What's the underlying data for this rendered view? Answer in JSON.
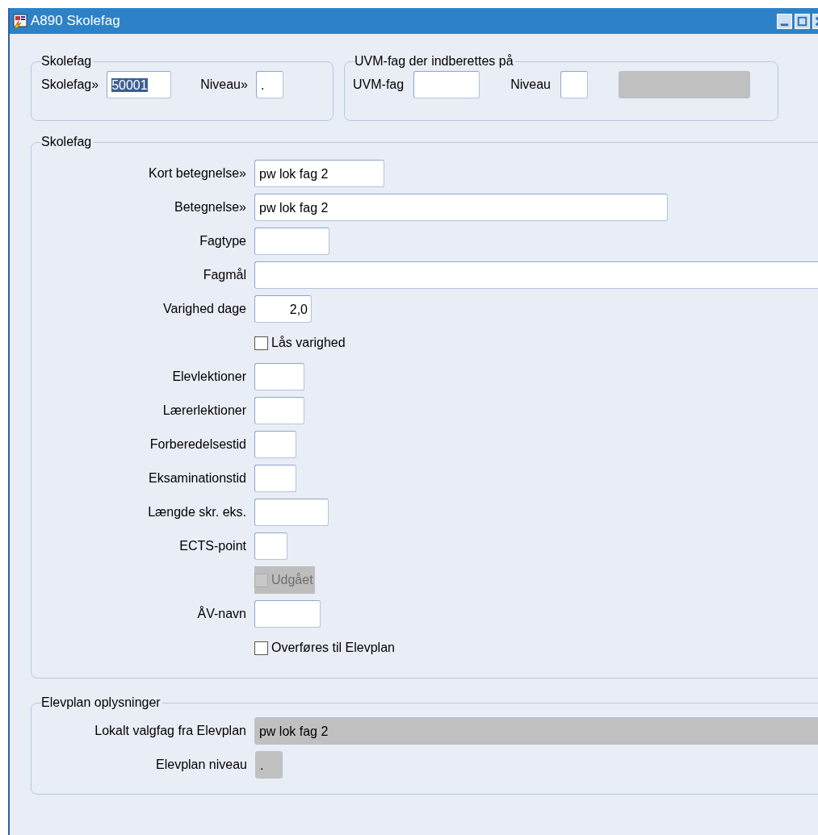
{
  "window": {
    "title": "A890 Skolefag"
  },
  "skolefag_group": {
    "title": "Skolefag",
    "fields": [
      {
        "label": "Skolefag»",
        "value": "50001",
        "selected": true,
        "disabled": false
      },
      {
        "label": "Niveau»",
        "value": ".",
        "selected": false,
        "disabled": false
      }
    ]
  },
  "uvm_group": {
    "title": "UVM-fag der indberettes på",
    "fields": [
      {
        "label": "UVM-fag",
        "disabled": false
      },
      {
        "label": "Niveau",
        "disabled": false
      },
      {
        "disabled": true
      }
    ]
  },
  "details_group": {
    "title": "Skolefag",
    "rows": [
      {
        "kind": "text",
        "label": "Kort betegnelse»",
        "value": "pw lok fag 2"
      },
      {
        "kind": "text",
        "label": "Betegnelse»",
        "value": "pw lok fag 2"
      },
      {
        "kind": "text",
        "label": "Fagtype"
      },
      {
        "kind": "text",
        "label": "Fagmål"
      },
      {
        "kind": "text",
        "label": "Varighed dage",
        "value": "2,0"
      },
      {
        "kind": "checkbox",
        "label": "Lås varighed",
        "checked": false,
        "disabled": false
      },
      {
        "kind": "text",
        "label": "Elevlektioner"
      },
      {
        "kind": "text",
        "label": "Lærerlektioner"
      },
      {
        "kind": "text",
        "label": "Forberedelsestid"
      },
      {
        "kind": "text",
        "label": "Eksaminationstid"
      },
      {
        "kind": "text",
        "label": "Længde skr. eks."
      },
      {
        "kind": "text",
        "label": "ECTS-point"
      },
      {
        "kind": "checkbox",
        "label": "Udgået",
        "checked": false,
        "disabled": true
      },
      {
        "kind": "text",
        "label": "ÅV-navn"
      },
      {
        "kind": "checkbox",
        "label": "Overføres til Elevplan",
        "checked": false,
        "disabled": false
      }
    ]
  },
  "elevplan_group": {
    "title": "Elevplan oplysninger",
    "fields": [
      {
        "label": "Lokalt valgfag fra Elevplan",
        "value": "pw lok fag 2",
        "disabled": true
      },
      {
        "label": "Elevplan niveau",
        "value": ".",
        "disabled": true
      }
    ]
  }
}
